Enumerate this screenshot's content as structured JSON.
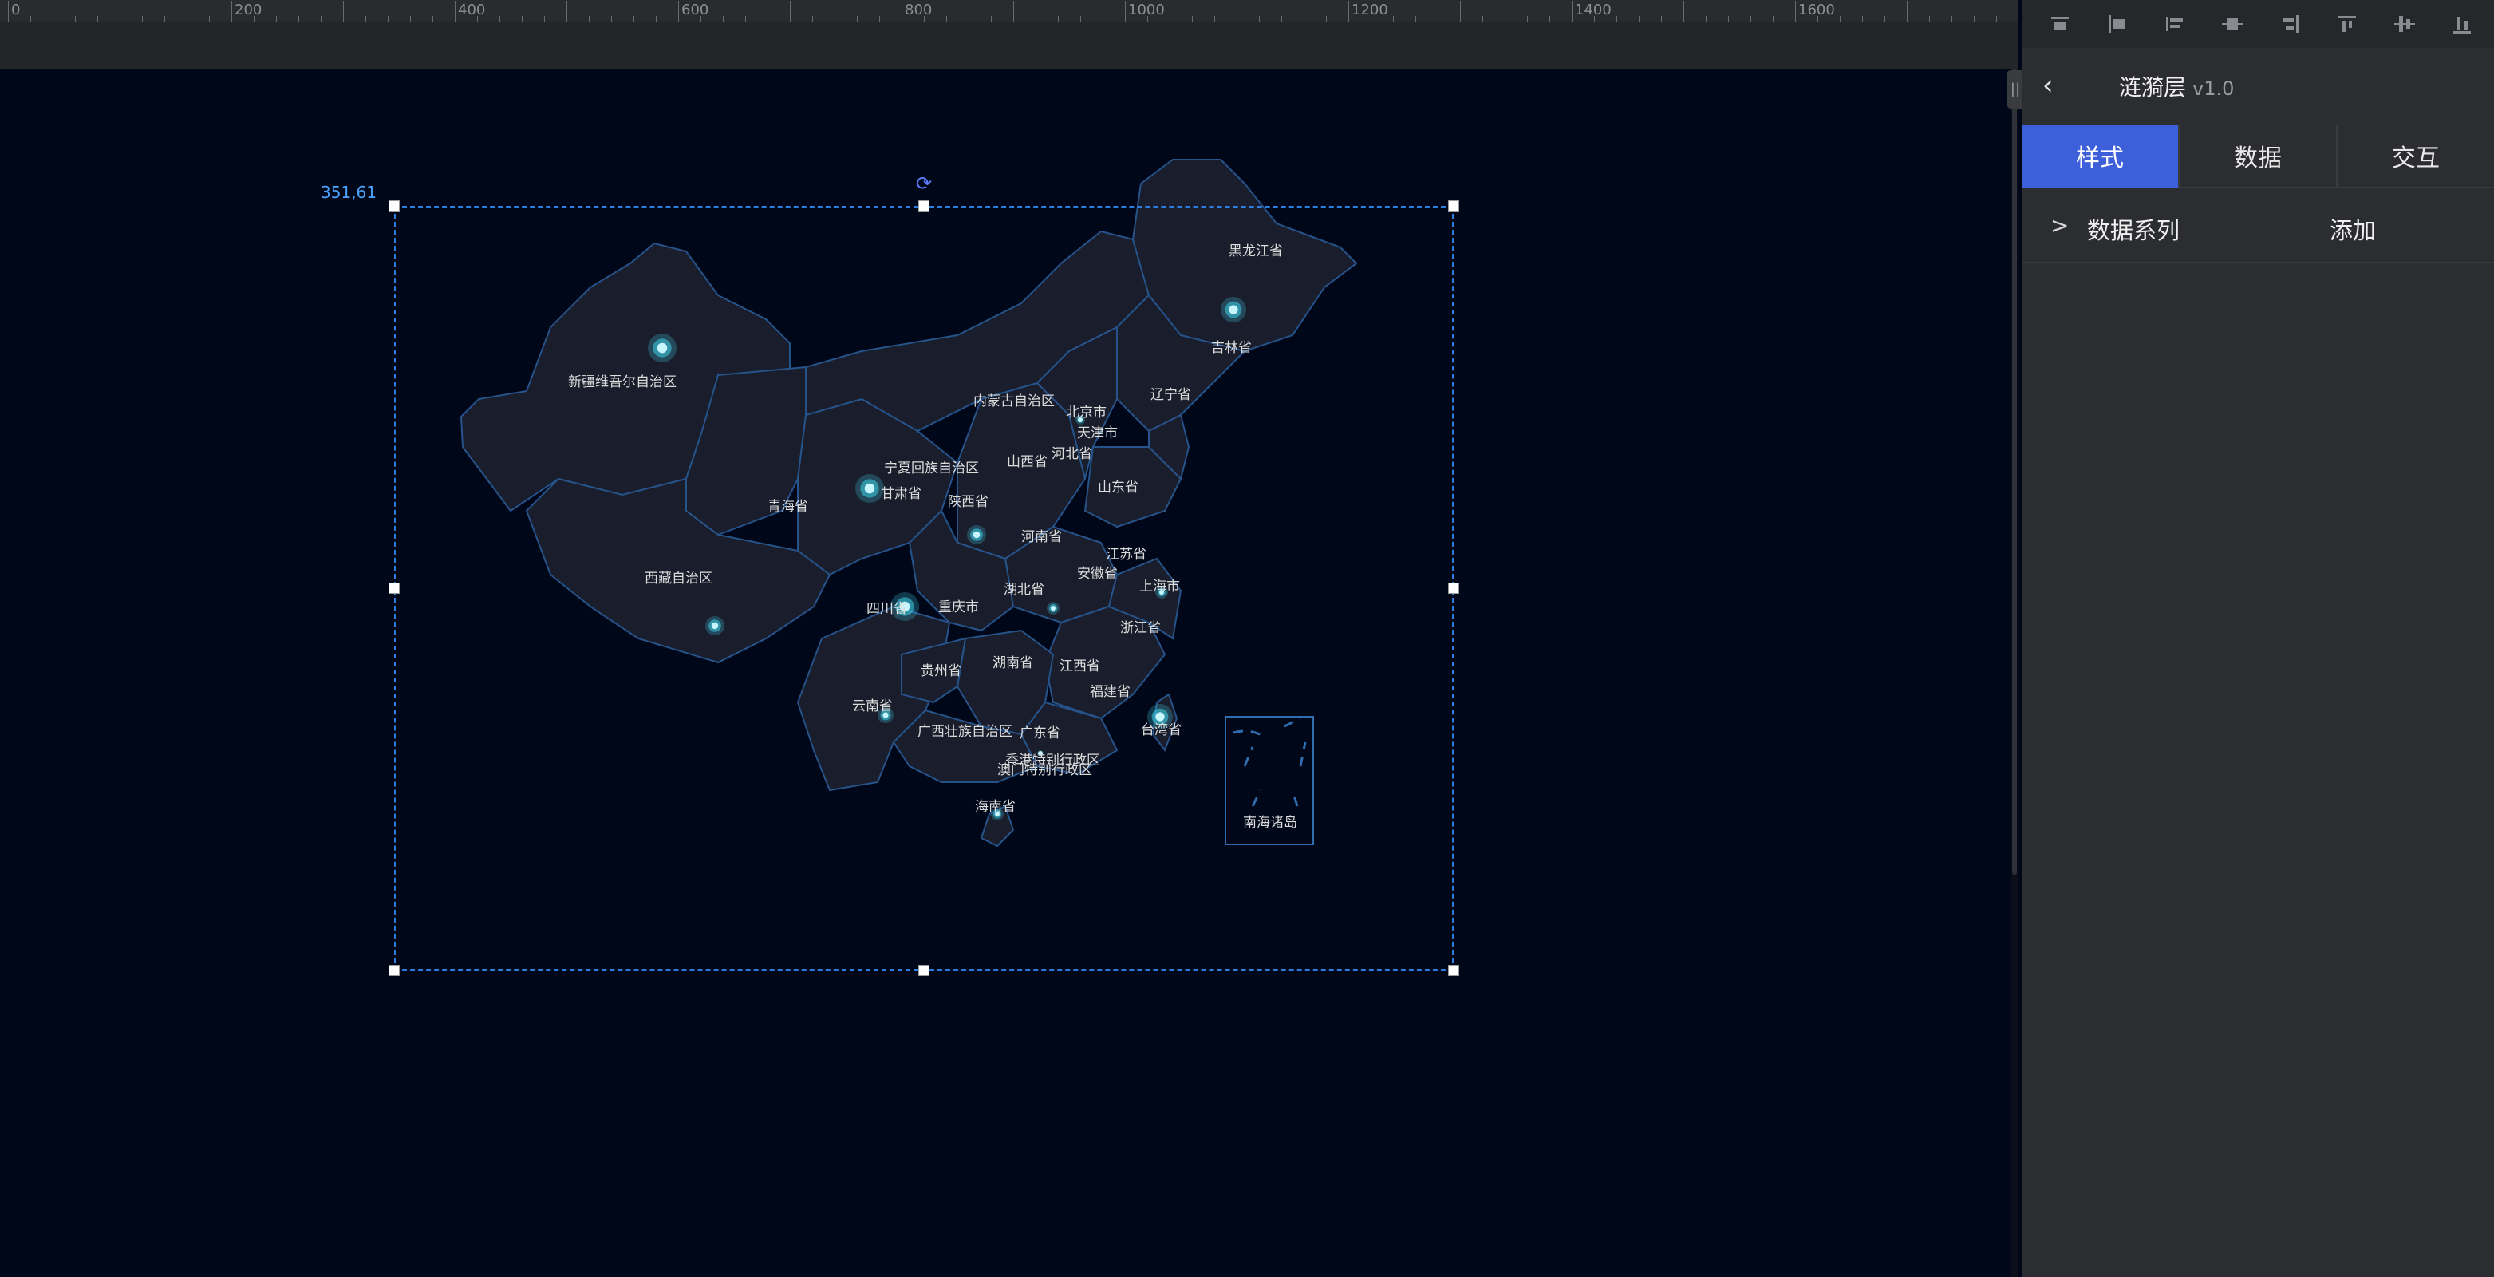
{
  "ruler": {
    "labels": [
      "0",
      "200",
      "400",
      "600",
      "800",
      "1000",
      "1200",
      "1400",
      "1600"
    ]
  },
  "canvas": {
    "coord_readout": "351,61",
    "rotate_icon": "rotate-icon"
  },
  "map": {
    "labels": [
      {
        "text": "黑龙江省",
        "id": "heilongjiang"
      },
      {
        "text": "吉林省",
        "id": "jilin"
      },
      {
        "text": "辽宁省",
        "id": "liaoning"
      },
      {
        "text": "新疆维吾尔自治区",
        "id": "xinjiang"
      },
      {
        "text": "内蒙古自治区",
        "id": "neimenggu"
      },
      {
        "text": "北京市",
        "id": "beijing"
      },
      {
        "text": "天津市",
        "id": "tianjin"
      },
      {
        "text": "宁夏回族自治区",
        "id": "ningxia"
      },
      {
        "text": "山西省",
        "id": "shanxi"
      },
      {
        "text": "河北省",
        "id": "hebei"
      },
      {
        "text": "甘肃省",
        "id": "gansu"
      },
      {
        "text": "山东省",
        "id": "shandong"
      },
      {
        "text": "青海省",
        "id": "qinghai"
      },
      {
        "text": "陕西省",
        "id": "shaanxi"
      },
      {
        "text": "河南省",
        "id": "henan"
      },
      {
        "text": "江苏省",
        "id": "jiangsu"
      },
      {
        "text": "西藏自治区",
        "id": "xizang"
      },
      {
        "text": "安徽省",
        "id": "anhui"
      },
      {
        "text": "湖北省",
        "id": "hubei"
      },
      {
        "text": "上海市",
        "id": "shanghai"
      },
      {
        "text": "四川省",
        "id": "sichuan"
      },
      {
        "text": "重庆市",
        "id": "chongqing"
      },
      {
        "text": "浙江省",
        "id": "zhejiang"
      },
      {
        "text": "湖南省",
        "id": "hunan"
      },
      {
        "text": "贵州省",
        "id": "guizhou"
      },
      {
        "text": "江西省",
        "id": "jiangxi"
      },
      {
        "text": "福建省",
        "id": "fujian"
      },
      {
        "text": "云南省",
        "id": "yunnan"
      },
      {
        "text": "台湾省",
        "id": "taiwan"
      },
      {
        "text": "广西壮族自治区",
        "id": "guangxi"
      },
      {
        "text": "广东省",
        "id": "guangdong"
      },
      {
        "text": "香港特别行政区",
        "id": "xianggang"
      },
      {
        "text": "澳门特别行政区",
        "id": "aomen"
      },
      {
        "text": "海南省",
        "id": "hainan"
      },
      {
        "text": "南海诸岛",
        "id": "nanhai"
      }
    ],
    "colors": {
      "land": "#1a1d2b",
      "border": "#25538a",
      "ripple": "#3fd0e8"
    }
  },
  "panel": {
    "back_icon": "chevron-left-icon",
    "title": "涟漪层",
    "version": "v1.0",
    "tabs": [
      "样式",
      "数据",
      "交互"
    ],
    "active_tab": "样式",
    "series_label": "数据系列",
    "series_add": "添加",
    "accent_color": "#3d5fd9"
  }
}
